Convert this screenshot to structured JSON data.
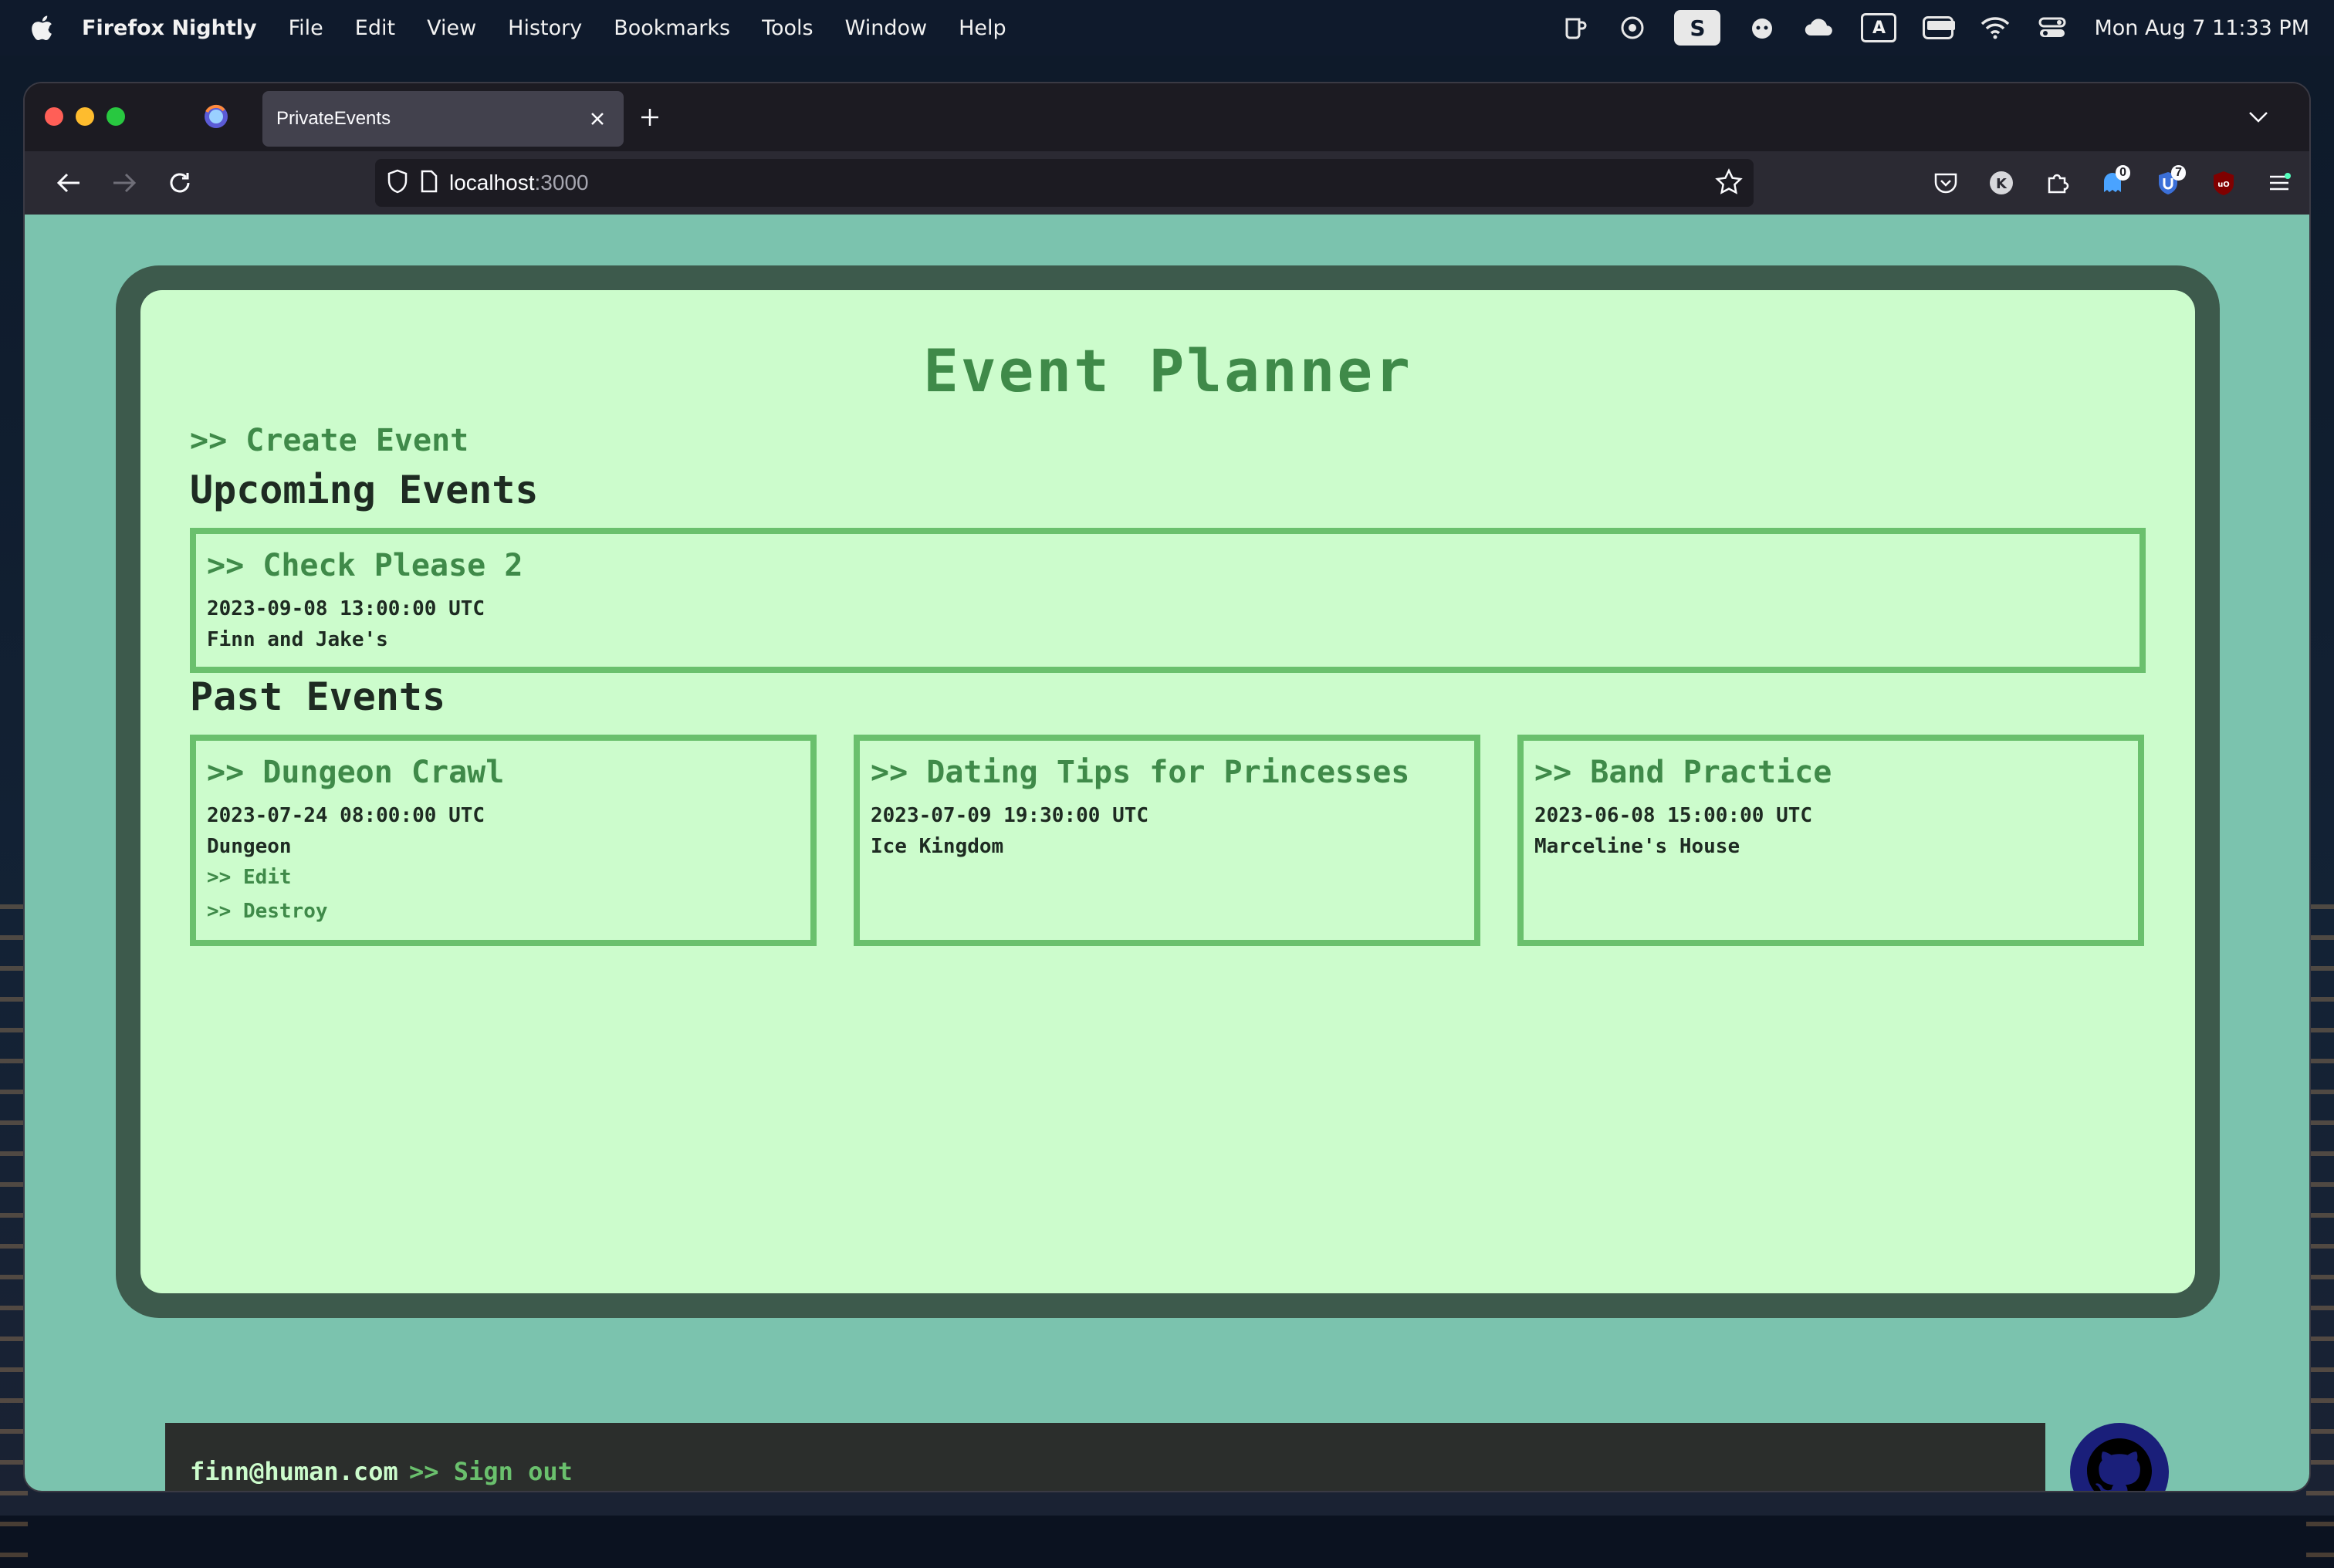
{
  "menubar": {
    "app_name": "Firefox Nightly",
    "menus": [
      "File",
      "Edit",
      "View",
      "History",
      "Bookmarks",
      "Tools",
      "Window",
      "Help"
    ],
    "status": {
      "s_icon": "S",
      "a_icon": "A",
      "clock": "Mon Aug 7  11:33 PM"
    }
  },
  "browser": {
    "tab_title": "PrivateEvents",
    "url_host": "localhost",
    "url_port": ":3000",
    "badges": {
      "notifications": "0",
      "extension": "7"
    }
  },
  "page": {
    "title": "Event Planner",
    "create_link": ">> Create Event",
    "upcoming_heading": "Upcoming Events",
    "past_heading": "Past Events",
    "upcoming_events": [
      {
        "title": ">> Check Please 2",
        "date": "2023-09-08 13:00:00 UTC",
        "location": "Finn and Jake's"
      }
    ],
    "past_events": [
      {
        "title": ">> Dungeon Crawl",
        "date": "2023-07-24 08:00:00 UTC",
        "location": "Dungeon",
        "edit": ">> Edit",
        "destroy": ">> Destroy"
      },
      {
        "title": ">> Dating Tips for Princesses",
        "date": "2023-07-09 19:30:00 UTC",
        "location": "Ice Kingdom"
      },
      {
        "title": ">> Band Practice",
        "date": "2023-06-08 15:00:00 UTC",
        "location": "Marceline's House"
      }
    ],
    "footer": {
      "email": "finn@human.com",
      "sign_out": ">> Sign out"
    }
  },
  "colors": {
    "page_bg": "#7bc3ae",
    "frame": "#3d5a4c",
    "screen": "#ccfccc",
    "accent_green": "#3f8a49",
    "card_border": "#6ac06d",
    "footer_bg": "#2b2e2c",
    "github_bg": "#1a1f7a"
  }
}
